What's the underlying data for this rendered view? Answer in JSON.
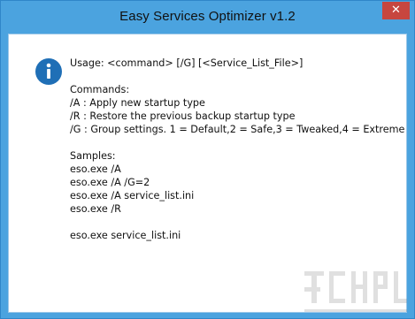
{
  "window": {
    "title": "Easy Services Optimizer v1.2",
    "close_label": "✕"
  },
  "dialog": {
    "icon": "info-icon",
    "lines": [
      "Usage: <command> [/G] [<Service_List_File>]",
      "",
      "Commands:",
      "/A : Apply new startup type",
      "/R : Restore the previous backup startup type",
      "/G : Group settings. 1 = Default,2 = Safe,3 = Tweaked,4 = Extreme",
      "",
      "Samples:",
      "eso.exe /A",
      "eso.exe /A /G=2",
      "eso.exe /A service_list.ini",
      "eso.exe /R",
      "",
      "eso.exe service_list.ini"
    ]
  },
  "colors": {
    "frame": "#4ba3df",
    "close": "#c7463f",
    "info_icon": "#1f6fb6"
  }
}
